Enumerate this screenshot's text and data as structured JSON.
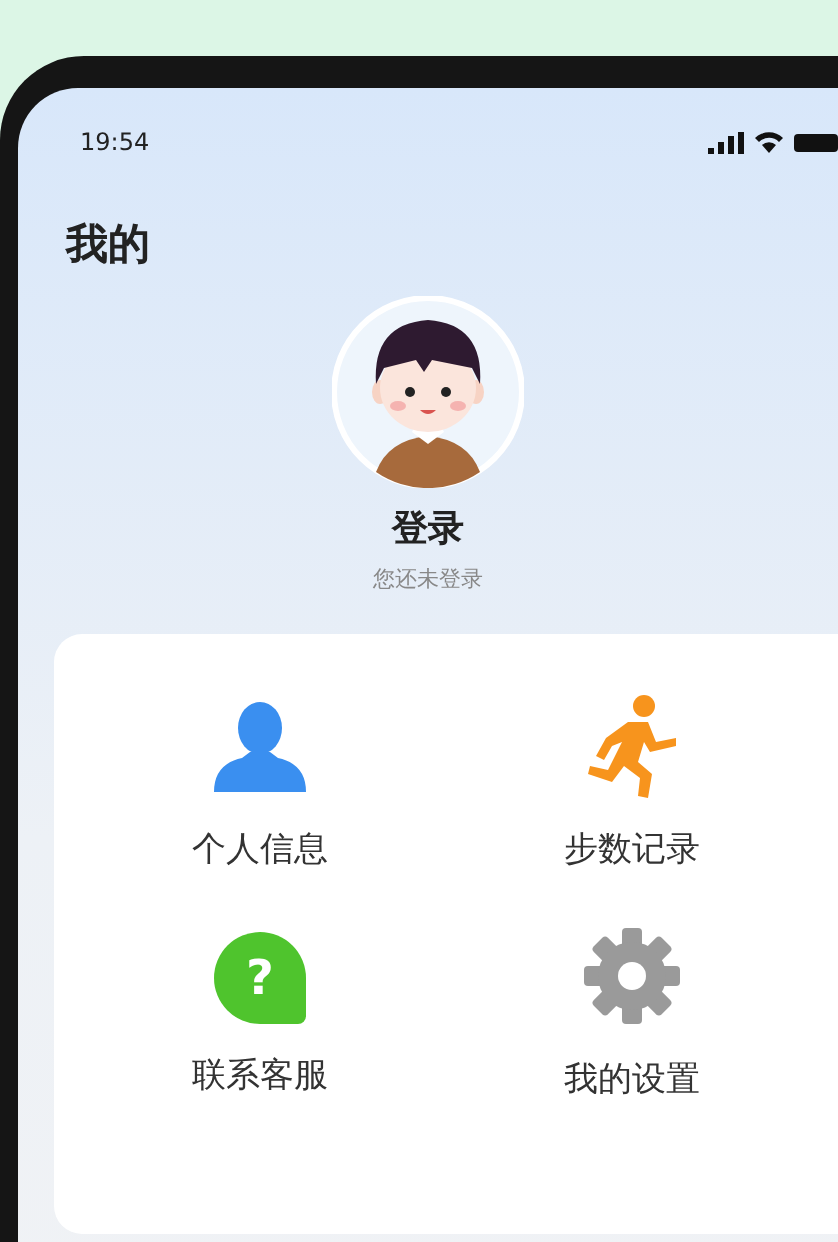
{
  "status_bar": {
    "time": "19:54"
  },
  "page_title": "我的",
  "profile": {
    "name": "登录",
    "subtitle": "您还未登录"
  },
  "menu": [
    {
      "kind": "person",
      "label": "个人信息"
    },
    {
      "kind": "runner",
      "label": "步数记录"
    },
    {
      "kind": "help",
      "glyph": "?",
      "label": "联系客服"
    },
    {
      "kind": "gear",
      "label": "我的设置"
    }
  ]
}
